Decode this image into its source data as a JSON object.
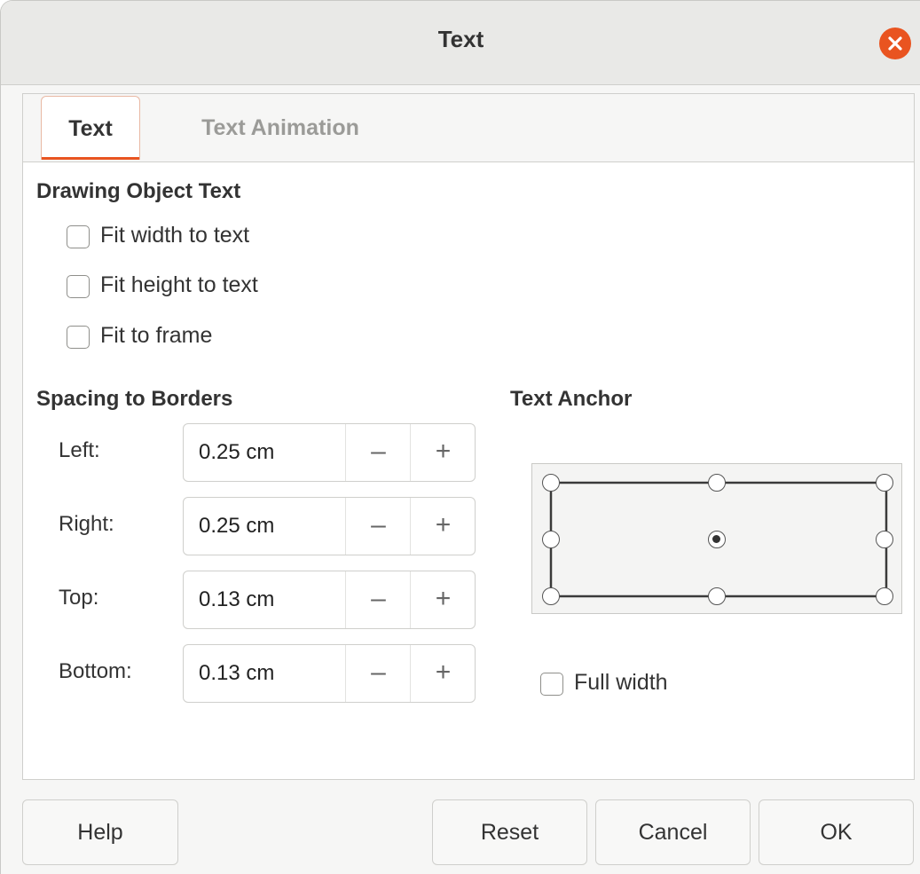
{
  "dialog": {
    "title": "Text",
    "close_icon": "close-icon",
    "accent_color": "#e95420"
  },
  "tabs": [
    {
      "label": "Text",
      "active": true
    },
    {
      "label": "Text Animation",
      "active": false
    }
  ],
  "drawing_object_text": {
    "heading": "Drawing Object Text",
    "options": [
      {
        "label": "Fit width to text",
        "checked": false
      },
      {
        "label": "Fit height to text",
        "checked": false
      },
      {
        "label": "Fit to frame",
        "checked": false
      }
    ]
  },
  "spacing": {
    "heading": "Spacing to Borders",
    "fields": [
      {
        "label": "Left:",
        "value": "0.25 cm"
      },
      {
        "label": "Right:",
        "value": "0.25 cm"
      },
      {
        "label": "Top:",
        "value": "0.13 cm"
      },
      {
        "label": "Bottom:",
        "value": "0.13 cm"
      }
    ],
    "minus_icon": "minus-icon",
    "plus_icon": "plus-icon"
  },
  "text_anchor": {
    "heading": "Text Anchor",
    "selected": "center",
    "full_width": {
      "label": "Full width",
      "checked": false
    }
  },
  "footer": {
    "help": "Help",
    "reset": "Reset",
    "cancel": "Cancel",
    "ok": "OK"
  }
}
